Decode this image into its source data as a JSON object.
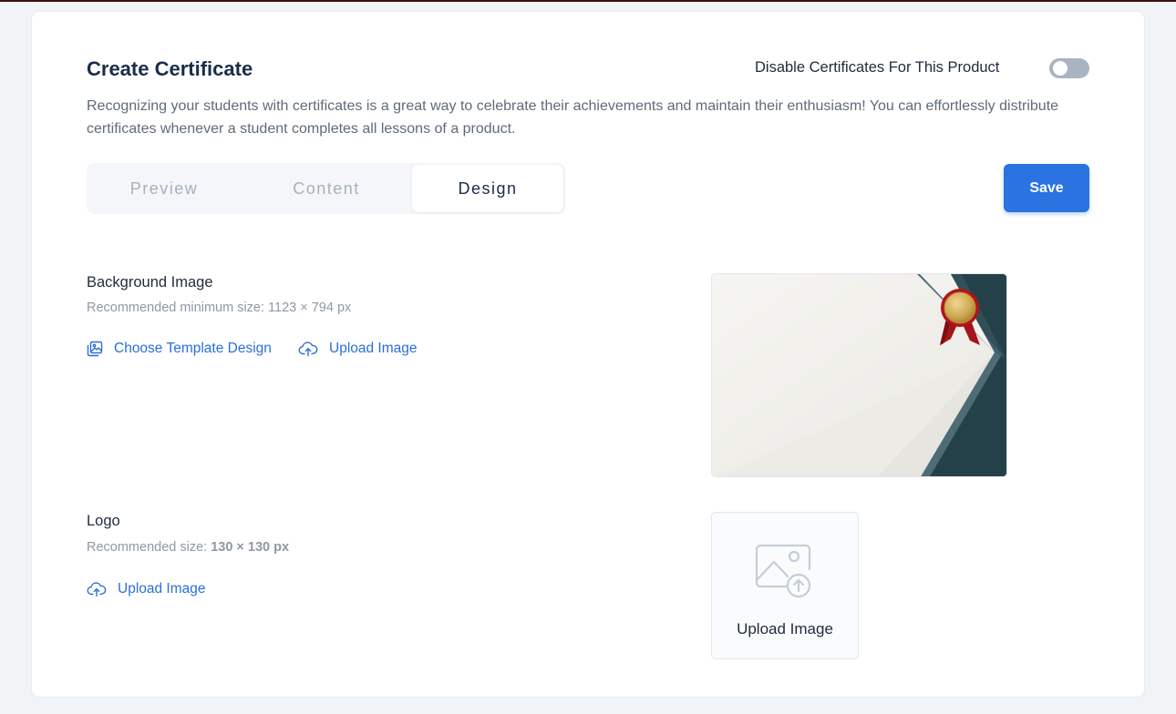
{
  "header": {
    "title": "Create Certificate",
    "toggle_label": "Disable Certificates For This Product",
    "toggle_on": false,
    "description": "Recognizing your students with certificates is a great way to celebrate their achievements and maintain their enthusiasm! You can effortlessly distribute certificates whenever a student completes all lessons of a product."
  },
  "tabs": [
    {
      "label": "Preview",
      "active": false
    },
    {
      "label": "Content",
      "active": false
    },
    {
      "label": "Design",
      "active": true
    }
  ],
  "toolbar": {
    "save_label": "Save"
  },
  "background_image": {
    "title": "Background Image",
    "hint": "Recommended minimum size: 1123 × 794 px",
    "choose_label": "Choose Template Design",
    "choose_icon": "image-gallery-icon",
    "upload_label": "Upload Image",
    "upload_icon": "cloud-upload-icon"
  },
  "logo": {
    "title": "Logo",
    "hint_prefix": "Recommended size: ",
    "hint_size": "130 × 130 px",
    "upload_label": "Upload Image",
    "upload_icon": "cloud-upload-icon",
    "box_label": "Upload Image",
    "box_icon": "image-upload-icon"
  },
  "colors": {
    "accent": "#2a73e0",
    "link": "#2a6fd6",
    "title": "#1a2d4a",
    "certificate_dark": "#24414a",
    "seal_gold": "#d1ab56",
    "ribbon_red": "#a3151a"
  }
}
